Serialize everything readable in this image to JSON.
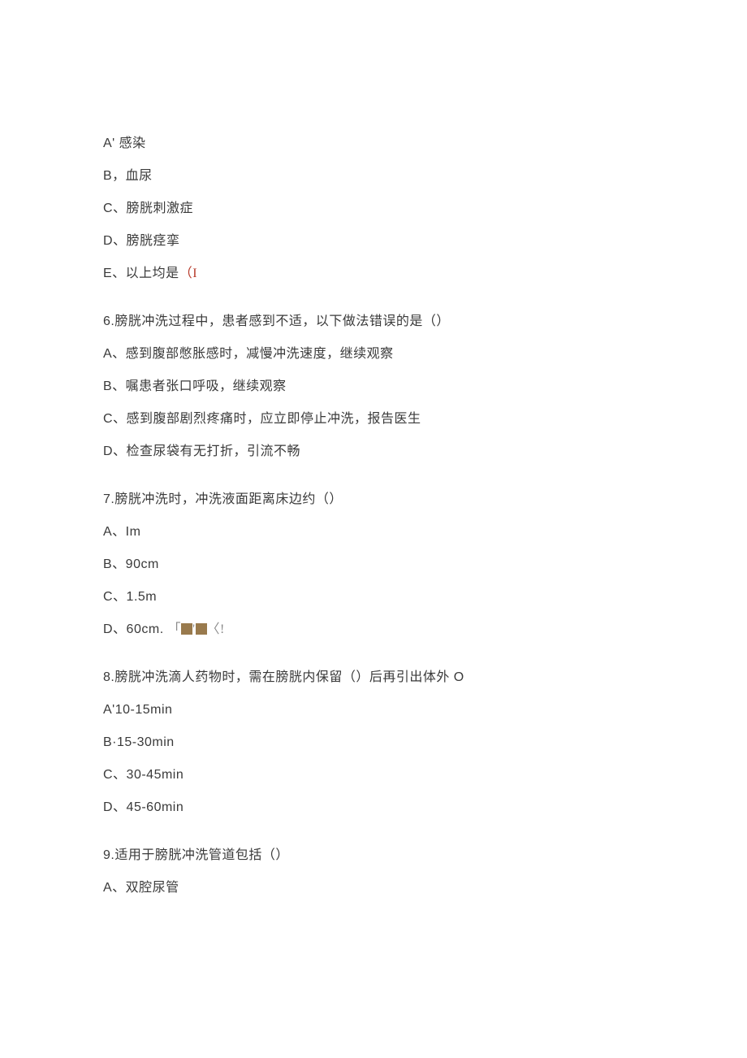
{
  "q5": {
    "optA": "A' 感染",
    "optB": "B，血尿",
    "optC": "C、膀胱刺激症",
    "optD": "D、膀胱痉挛",
    "optE_prefix": "E、以上均是",
    "optE_mark": "（I"
  },
  "q6": {
    "stem": "6.膀胱冲洗过程中，患者感到不适，以下做法错误的是（）",
    "optA": "A、感到腹部憋胀感时，减慢冲洗速度，继续观察",
    "optB": "B、嘱患者张口呼吸，继续观察",
    "optC": "C、感到腹部剧烈疼痛时，应立即停止冲洗，报告医生",
    "optD": "D、检查尿袋有无打折，引流不畅"
  },
  "q7": {
    "stem": "7.膀胱冲洗时，冲洗液面距离床边约（）",
    "optA": "A、Im",
    "optB": "B、90cm",
    "optC": "C、1.5m",
    "optD_prefix": "D、60cm",
    "optD_dot": ".",
    "optD_sym_open": "「",
    "optD_sym_apos": "'",
    "optD_sym_close": "〈!"
  },
  "q8": {
    "stem": "8.膀胱冲洗滴人药物时，需在膀胱内保留（）后再引出体外 O",
    "optA": "A'10-15min",
    "optB": "B·15-30min",
    "optC": "C、30-45min",
    "optD": "D、45-60min"
  },
  "q9": {
    "stem": "9.适用于膀胱冲洗管道包括（）",
    "optA": "A、双腔尿管"
  }
}
